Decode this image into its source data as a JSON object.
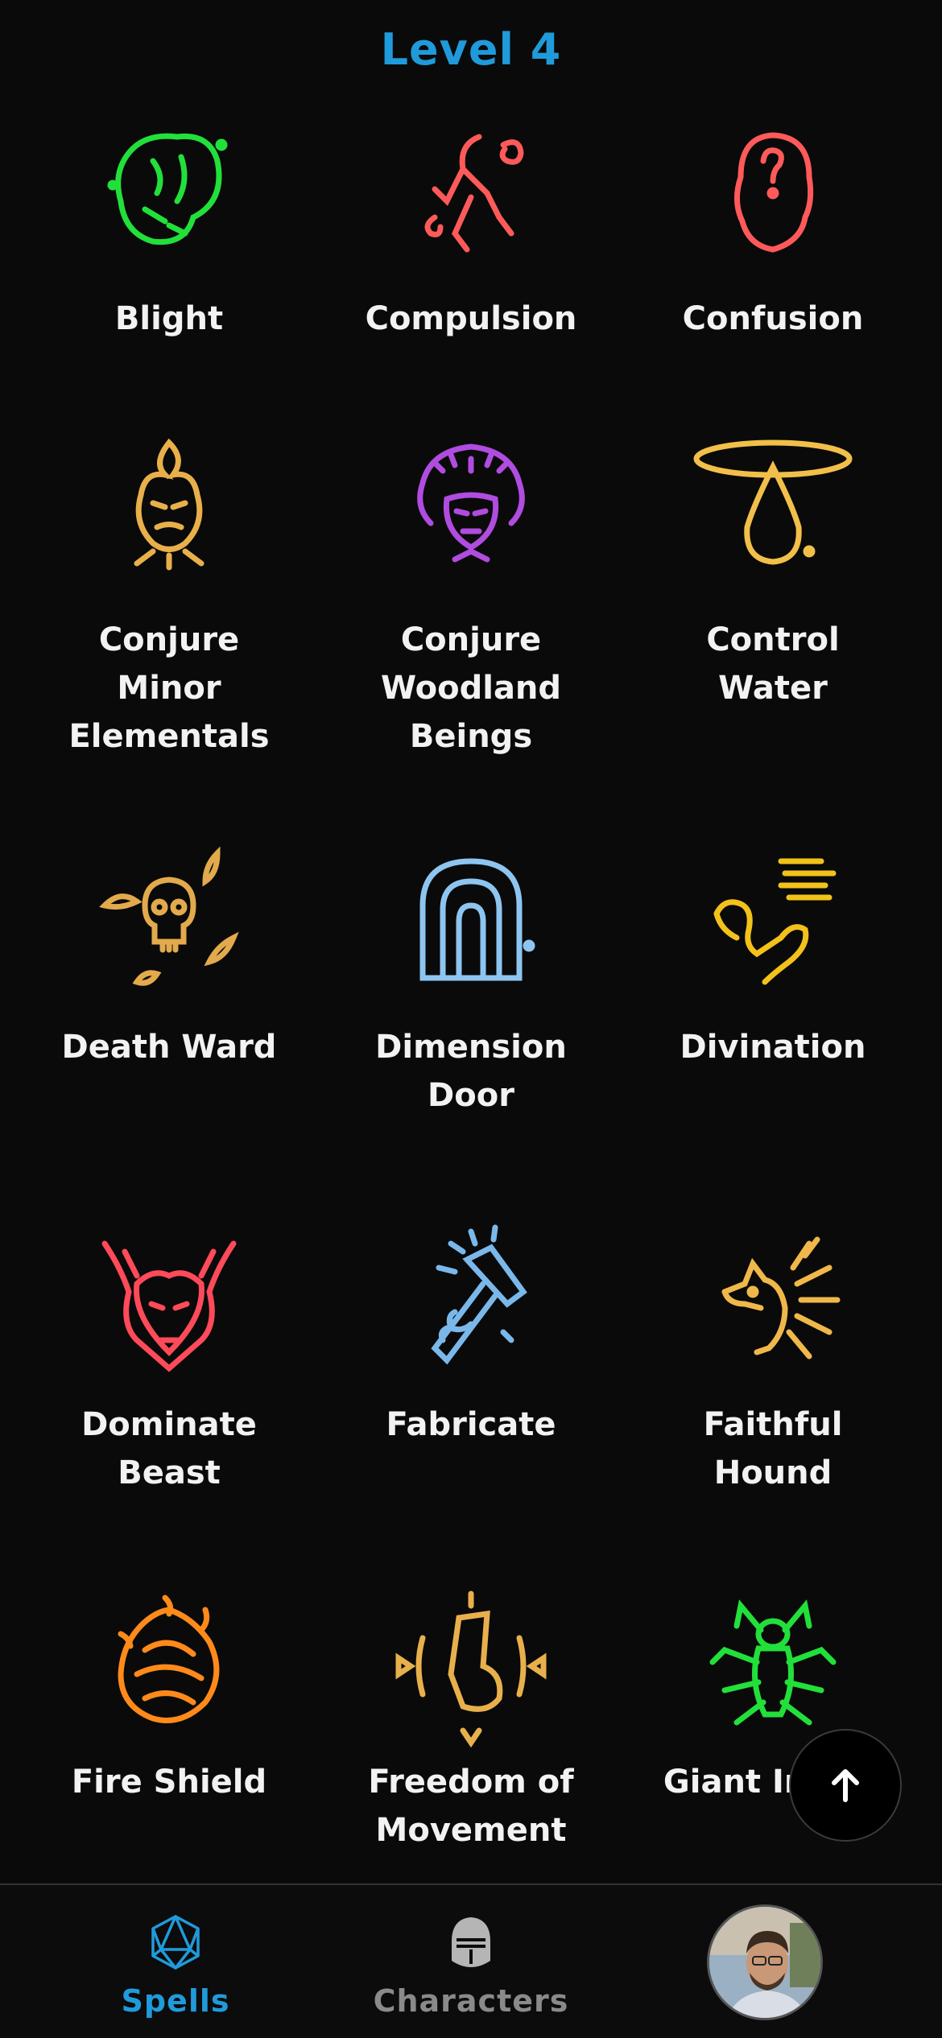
{
  "header": {
    "level_title": "Level 4"
  },
  "spells": [
    {
      "name": "Blight",
      "icon": "blight-icon",
      "color": "#22e03a"
    },
    {
      "name": "Compulsion",
      "icon": "compulsion-icon",
      "color": "#ff5a5a"
    },
    {
      "name": "Confusion",
      "icon": "confusion-icon",
      "color": "#ff5a5a"
    },
    {
      "name": "Conjure\nMinor\nElementals",
      "icon": "conjure-minor-elementals-icon",
      "color": "#e9b04a"
    },
    {
      "name": "Conjure\nWoodland\nBeings",
      "icon": "conjure-woodland-beings-icon",
      "color": "#b04ce0"
    },
    {
      "name": "Control\nWater",
      "icon": "control-water-icon",
      "color": "#f2bf4a"
    },
    {
      "name": "Death Ward",
      "icon": "death-ward-icon",
      "color": "#e2aa4c"
    },
    {
      "name": "Dimension\nDoor",
      "icon": "dimension-door-icon",
      "color": "#8ec5f0"
    },
    {
      "name": "Divination",
      "icon": "divination-icon",
      "color": "#f2c21a"
    },
    {
      "name": "Dominate\nBeast",
      "icon": "dominate-beast-icon",
      "color": "#ff4a5a"
    },
    {
      "name": "Fabricate",
      "icon": "fabricate-icon",
      "color": "#7ab8ea"
    },
    {
      "name": "Faithful\nHound",
      "icon": "faithful-hound-icon",
      "color": "#f0b84a"
    },
    {
      "name": "Fire Shield",
      "icon": "fire-shield-icon",
      "color": "#ff8a1a"
    },
    {
      "name": "Freedom of\nMovement",
      "icon": "freedom-of-movement-icon",
      "color": "#e8b04c"
    },
    {
      "name": "Giant Insect",
      "icon": "giant-insect-icon",
      "color": "#22e03a"
    }
  ],
  "scroll_top": {
    "icon": "arrow-up-icon"
  },
  "bottom_nav": {
    "items": [
      {
        "label": "Spells",
        "icon": "d20-icon",
        "active": true
      },
      {
        "label": "Characters",
        "icon": "knight-helmet-icon",
        "active": false
      }
    ],
    "profile": {
      "icon": "avatar"
    }
  },
  "colors": {
    "accent": "#1f9bdb",
    "background": "#0a0a0a",
    "inactive": "#8a8a8a"
  }
}
